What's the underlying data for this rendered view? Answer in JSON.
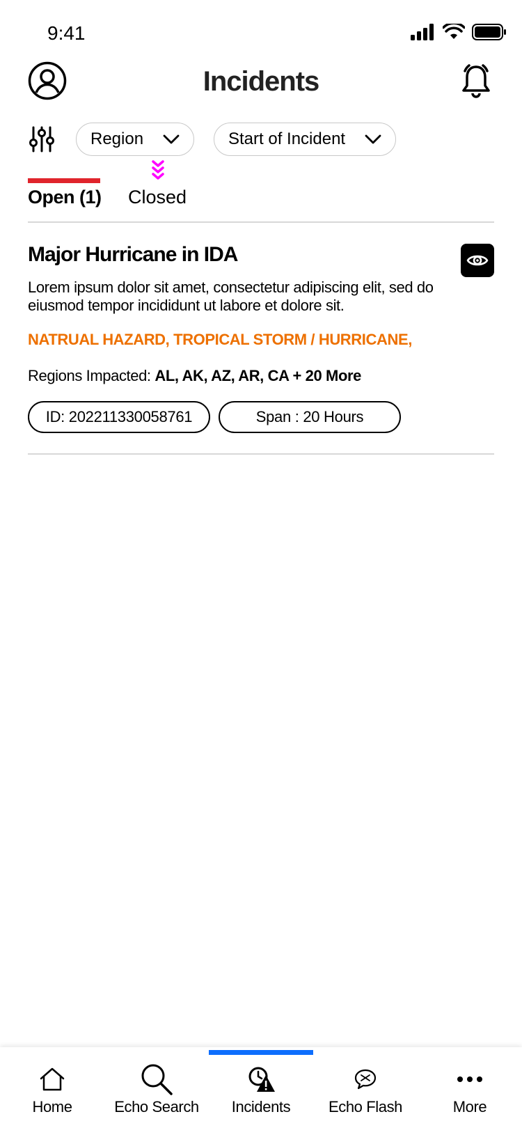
{
  "status_bar": {
    "time": "9:41"
  },
  "header": {
    "title": "Incidents"
  },
  "filters": {
    "region_label": "Region",
    "start_label": "Start of Incident"
  },
  "tabs": {
    "open_label": "Open (1)",
    "closed_label": "Closed",
    "active": "Open (1)"
  },
  "incident": {
    "title": "Major Hurricane in IDA",
    "description": "Lorem ipsum dolor sit amet, consectetur adipiscing elit, sed do eiusmod tempor incididunt ut labore et dolore sit.",
    "tags": "NATRUAL HAZARD, TROPICAL STORM / HURRICANE,",
    "regions_prefix": "Regions Impacted: ",
    "regions_value": "AL, AK, AZ, AR, CA + 20 More",
    "id_label": "ID: 202211330058761",
    "span_label": "Span : 20 Hours"
  },
  "bottom_nav": {
    "items": [
      {
        "label": "Home",
        "icon": "home-icon"
      },
      {
        "label": "Echo Search",
        "icon": "search-icon"
      },
      {
        "label": "Incidents",
        "icon": "incident-alert-icon"
      },
      {
        "label": "Echo Flash",
        "icon": "chat-bubble-icon"
      },
      {
        "label": "More",
        "icon": "more-dots-icon"
      }
    ],
    "active": "Incidents"
  },
  "colors": {
    "tab_accent": "#e0242c",
    "tag_text": "#ed7000",
    "nav_accent": "#0d6efd"
  }
}
